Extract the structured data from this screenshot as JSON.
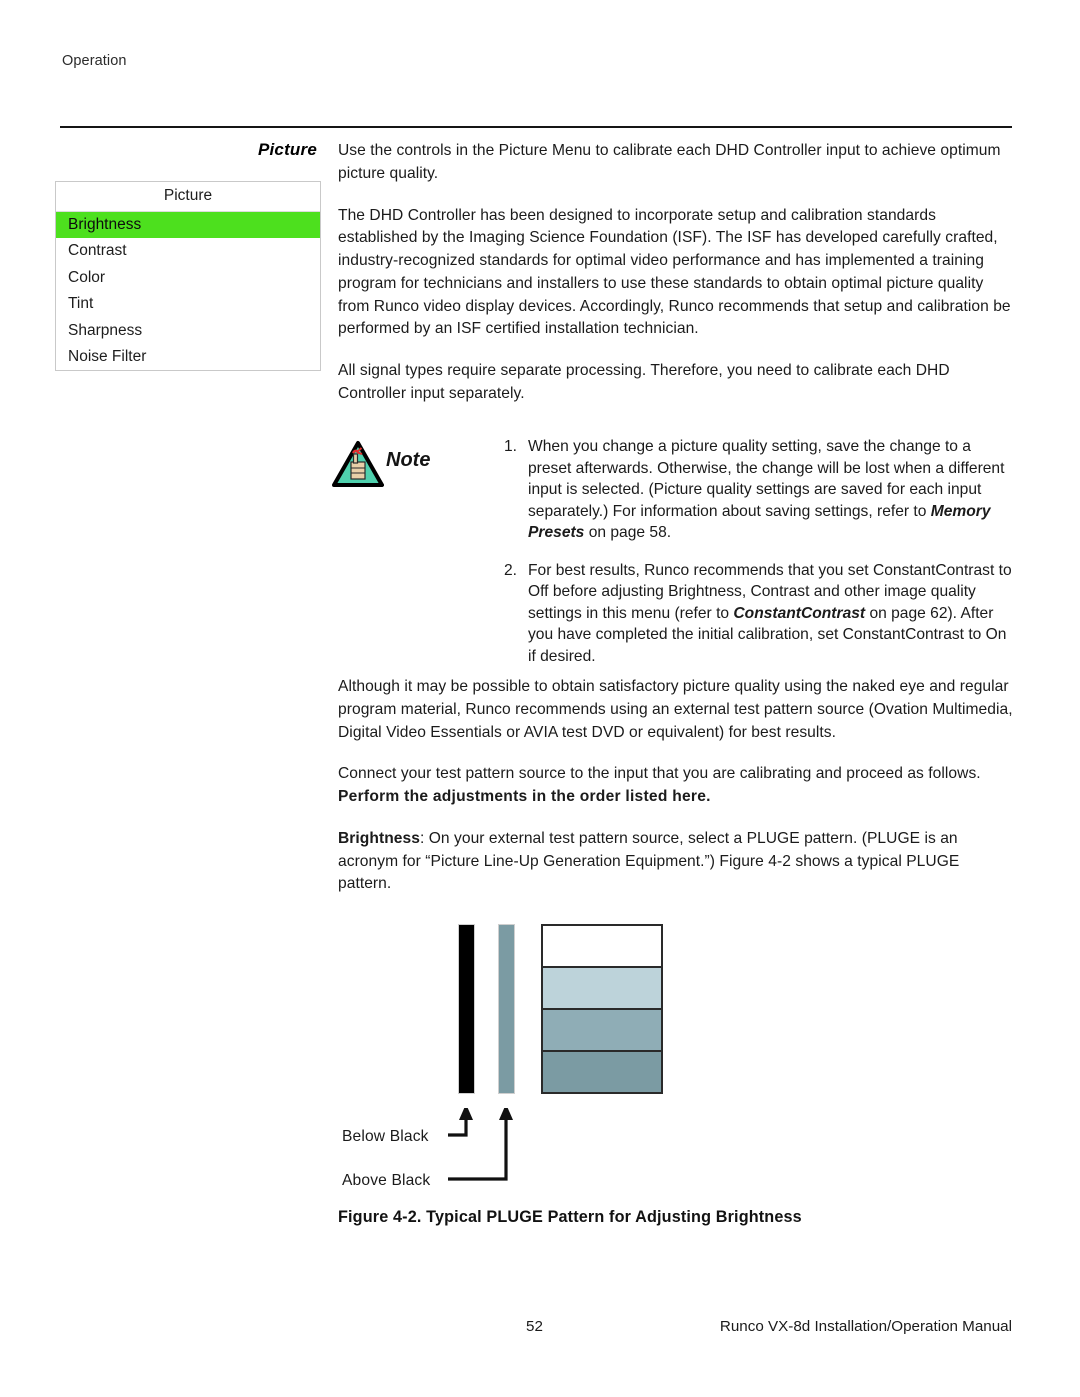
{
  "page": {
    "running_head": "Operation",
    "footer_page_number": "52",
    "footer_manual": "Runco VX-8d Installation/Operation Manual"
  },
  "margin": {
    "heading": "Picture"
  },
  "osd_menu": {
    "title": "Picture",
    "highlight_color": "#4de01e",
    "items": [
      {
        "label": "Brightness",
        "selected": true
      },
      {
        "label": "Contrast",
        "selected": false
      },
      {
        "label": "Color",
        "selected": false
      },
      {
        "label": "Tint",
        "selected": false
      },
      {
        "label": "Sharpness",
        "selected": false
      },
      {
        "label": "Noise Filter",
        "selected": false
      }
    ]
  },
  "body": {
    "p1": "Use the controls in the Picture Menu to calibrate each DHD Controller input to achieve optimum picture quality.",
    "p2": "The DHD Controller has been designed to incorporate setup and calibration standards established by the Imaging Science Foundation (ISF). The ISF has developed carefully crafted, industry-recognized standards for optimal video performance and has implemented a training program for technicians and installers to use these standards to obtain optimal picture quality from Runco video display devices. Accordingly, Runco recommends that setup and calibration be performed by an ISF certified installation technician.",
    "p3": "All signal types require separate processing. Therefore, you need to calibrate each DHD Controller input separately.",
    "p4": "Although it may be possible to obtain satisfactory picture quality using the naked eye and regular program material, Runco recommends using an external test pattern source (Ovation Multimedia, Digital Video Essentials or AVIA test DVD or equivalent) for best results.",
    "p5_lead": "Connect your test pattern source to the input that you are calibrating and proceed as follows. ",
    "p5_bold": "Perform the adjustments in the order listed here.",
    "p6_label": "Brightness",
    "p6_rest": ": On your external test pattern source, select a PLUGE pattern. (PLUGE is an acronym for “Picture Line-Up Generation Equipment.”) Figure 4-2 shows a typical PLUGE pattern."
  },
  "note": {
    "word": "Note",
    "items": [
      {
        "number": "1.",
        "text_before": "When you change a picture quality setting, save the change to a preset afterwards. Otherwise, the change will be lost when a different input is selected. (Picture quality settings are saved for each input separately.) For information about saving settings, refer to ",
        "emphasis": "Memory Presets",
        "text_after": " on page 58."
      },
      {
        "number": "2.",
        "text_before": "For best results, Runco recommends that you set ConstantContrast to Off before adjusting Brightness, Contrast and other image quality settings in this menu (refer to ",
        "emphasis": "ConstantContrast",
        "text_after": " on page 62). After you have completed the initial calibration, set ConstantContrast to On if desired."
      }
    ]
  },
  "figure": {
    "caption": "Figure 4-2. Typical PLUGE Pattern for Adjusting Brightness",
    "callout_below_black": "Below Black",
    "callout_above_black": "Above Black",
    "bars": {
      "below_black_color": "#000000",
      "above_black_color": "#7b9ba3"
    },
    "stack_colors": [
      "#ffffff",
      "#bdd3da",
      "#8fadb6",
      "#7b9ba3"
    ]
  }
}
